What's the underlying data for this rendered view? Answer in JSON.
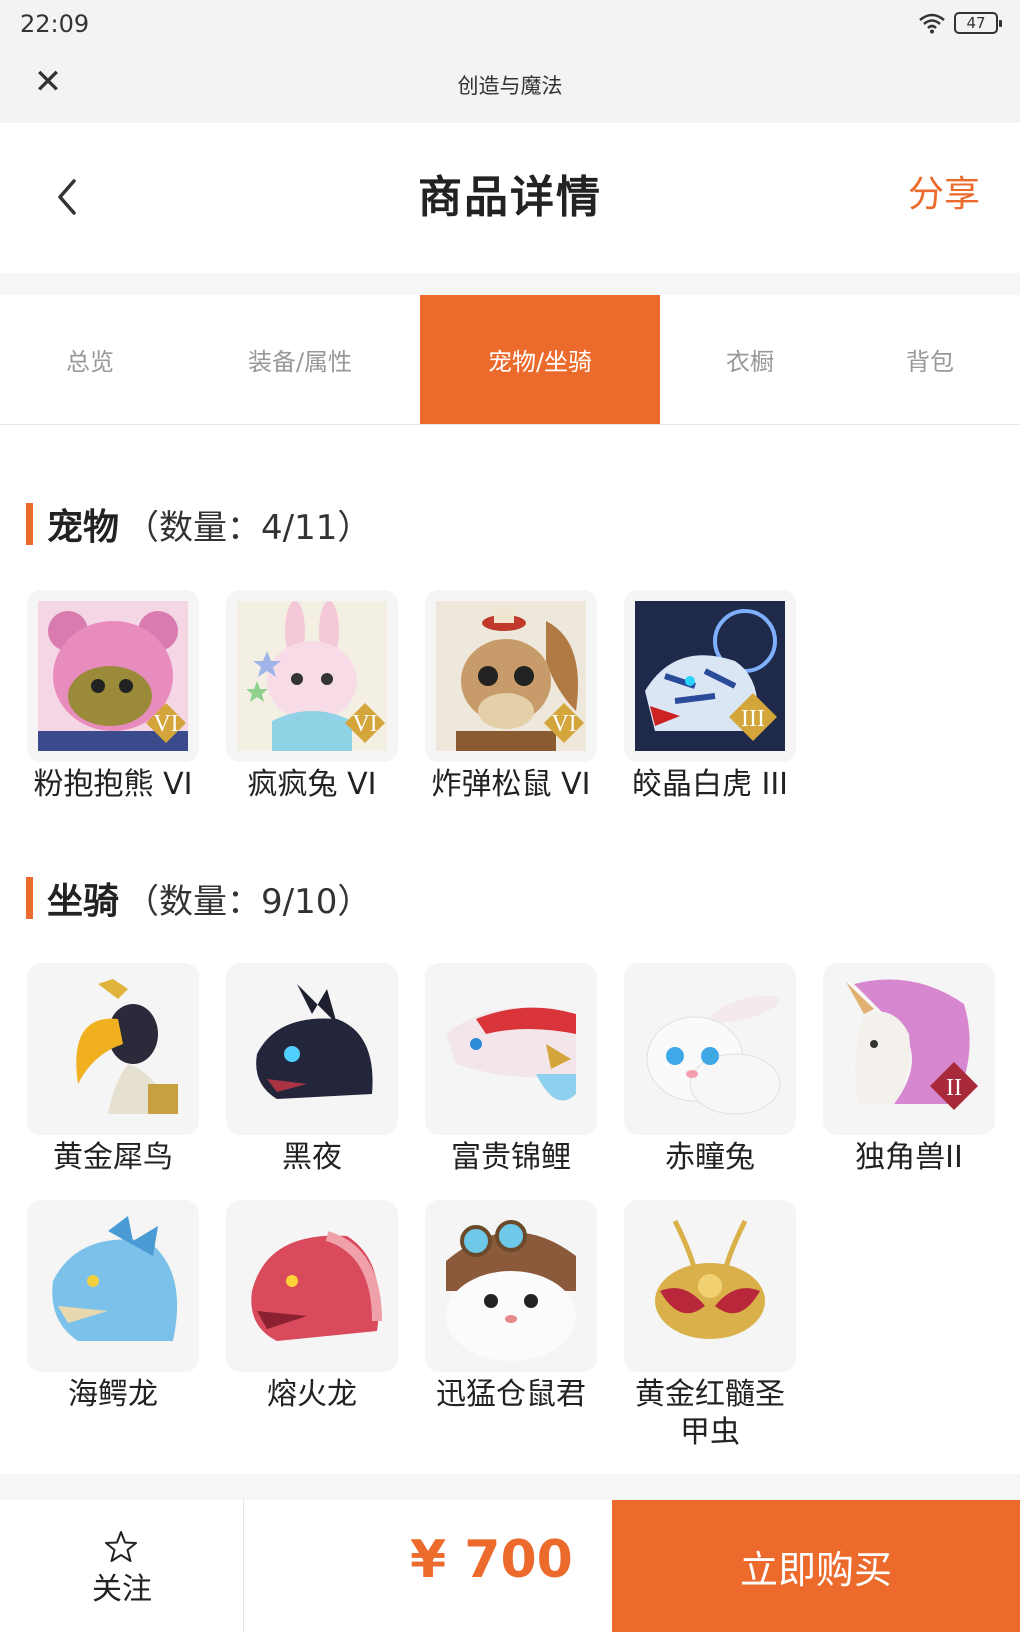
{
  "status": {
    "time": "22:09",
    "battery": "47"
  },
  "app_bar": {
    "title": "创造与魔法"
  },
  "header": {
    "title": "商品详情",
    "share_label": "分享"
  },
  "tabs": [
    {
      "label": "总览",
      "active": false
    },
    {
      "label": "装备/属性",
      "active": false
    },
    {
      "label": "宠物/坐骑",
      "active": true
    },
    {
      "label": "衣橱",
      "active": false
    },
    {
      "label": "背包",
      "active": false
    }
  ],
  "pets": {
    "title": "宠物",
    "count": "（数量：4/11）",
    "items": [
      {
        "name": "粉抱抱熊 VI",
        "icon": "pink-bear-icon",
        "badge": "VI"
      },
      {
        "name": "疯疯兔 VI",
        "icon": "crazy-rabbit-icon",
        "badge": "VI"
      },
      {
        "name": "炸弹松鼠 VI",
        "icon": "bomb-squirrel-icon",
        "badge": "VI"
      },
      {
        "name": "皎晶白虎 III",
        "icon": "white-tiger-icon",
        "badge": "III"
      }
    ]
  },
  "mounts": {
    "title": "坐骑",
    "count": "（数量：9/10）",
    "items": [
      {
        "name": "黄金犀鸟",
        "icon": "golden-hornbill-icon",
        "badge": ""
      },
      {
        "name": "黑夜",
        "icon": "black-night-dragon-icon",
        "badge": ""
      },
      {
        "name": "富贵锦鲤",
        "icon": "koi-fish-icon",
        "badge": ""
      },
      {
        "name": "赤瞳兔",
        "icon": "white-rabbit-icon",
        "badge": ""
      },
      {
        "name": "独角兽II",
        "icon": "unicorn-icon",
        "badge": "II"
      },
      {
        "name": "海鳄龙",
        "icon": "sea-dragon-icon",
        "badge": ""
      },
      {
        "name": "熔火龙",
        "icon": "lava-dragon-icon",
        "badge": ""
      },
      {
        "name": "迅猛仓鼠君",
        "icon": "hamster-icon",
        "badge": ""
      },
      {
        "name": "黄金红髓圣甲虫",
        "icon": "golden-scarab-icon",
        "badge": ""
      }
    ]
  },
  "bottom": {
    "follow_label": "关注",
    "price": "¥ 700",
    "buy_label": "立即购买"
  },
  "colors": {
    "accent": "#ec6a2c"
  }
}
